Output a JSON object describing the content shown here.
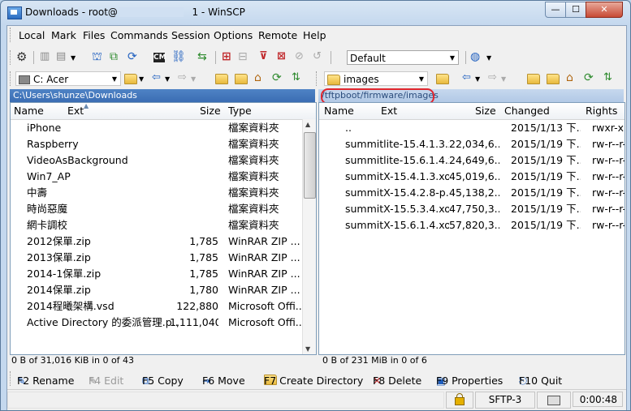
{
  "window": {
    "title": "Downloads - root@1                      1 - WinSCP",
    "min": "—",
    "max": "☐",
    "close": "✕"
  },
  "menu": [
    "Local",
    "Mark",
    "Files",
    "Commands",
    "Session",
    "Options",
    "Remote",
    "Help"
  ],
  "toolbar": {
    "transfer_profile": "Default"
  },
  "left": {
    "drive": "C: Acer",
    "path": "C:\\Users\\shunze\\Downloads",
    "columns": {
      "name": "Name",
      "ext": "Ext",
      "size": "Size",
      "type": "Type"
    },
    "rows": [
      {
        "name": "iPhone",
        "size": "",
        "type": "檔案資料夾",
        "icon": "folder"
      },
      {
        "name": "Raspberry",
        "size": "",
        "type": "檔案資料夾",
        "icon": "folder"
      },
      {
        "name": "VideoAsBackground",
        "size": "",
        "type": "檔案資料夾",
        "icon": "folder"
      },
      {
        "name": "Win7_AP",
        "size": "",
        "type": "檔案資料夾",
        "icon": "folder"
      },
      {
        "name": "中壽",
        "size": "",
        "type": "檔案資料夾",
        "icon": "folder"
      },
      {
        "name": "時尚惡魔",
        "size": "",
        "type": "檔案資料夾",
        "icon": "folder"
      },
      {
        "name": "網卡調校",
        "size": "",
        "type": "檔案資料夾",
        "icon": "folder"
      },
      {
        "name": "2012保單.zip",
        "size": "1,785",
        "type": "WinRAR ZIP ...",
        "icon": "zip"
      },
      {
        "name": "2013保單.zip",
        "size": "1,785",
        "type": "WinRAR ZIP ...",
        "icon": "zip"
      },
      {
        "name": "2014-1保單.zip",
        "size": "1,785",
        "type": "WinRAR ZIP ...",
        "icon": "zip"
      },
      {
        "name": "2014保單.zip",
        "size": "1,780",
        "type": "WinRAR ZIP ...",
        "icon": "zip"
      },
      {
        "name": "2014程曦架構.vsd",
        "size": "122,880",
        "type": "Microsoft Offi...",
        "icon": "visio"
      },
      {
        "name": "Active Directory 的委派管理.p...",
        "size": "1,111,040",
        "type": "Microsoft Offi...",
        "icon": "doc"
      }
    ],
    "status": "0 B of 31,016 KiB in 0 of 43"
  },
  "right": {
    "dir": "images",
    "path": "/tftpboot/firmware/images",
    "columns": {
      "name": "Name",
      "ext": "Ext",
      "size": "Size",
      "changed": "Changed",
      "rights": "Rights"
    },
    "rows": [
      {
        "name": "..",
        "size": "",
        "changed": "2015/1/13 下...",
        "rights": "rwxr-xr-x",
        "icon": "updir"
      },
      {
        "name": "summitlite-15.4.1.3.x...",
        "size": "22,034,6...",
        "changed": "2015/1/19 下...",
        "rights": "rw-r--r--",
        "icon": "doc"
      },
      {
        "name": "summitlite-15.6.1.4.x...",
        "size": "24,649,6...",
        "changed": "2015/1/19 下...",
        "rights": "rw-r--r--",
        "icon": "doc"
      },
      {
        "name": "summitX-15.4.1.3.xos",
        "size": "45,019,6...",
        "changed": "2015/1/19 下...",
        "rights": "rw-r--r--",
        "icon": "doc"
      },
      {
        "name": "summitX-15.4.2.8-p...",
        "size": "45,138,2...",
        "changed": "2015/1/19 下...",
        "rights": "rw-r--r--",
        "icon": "doc"
      },
      {
        "name": "summitX-15.5.3.4.xos",
        "size": "47,750,3...",
        "changed": "2015/1/19 下...",
        "rights": "rw-r--r--",
        "icon": "doc"
      },
      {
        "name": "summitX-15.6.1.4.xos",
        "size": "57,820,3...",
        "changed": "2015/1/19 下...",
        "rights": "rw-r--r--",
        "icon": "doc"
      }
    ],
    "status": "0 B of 231 MiB in 0 of 6"
  },
  "fkeys": [
    "F2 Rename",
    "F4 Edit",
    "F5 Copy",
    "F6 Move",
    "F7 Create Directory",
    "F8 Delete",
    "F9 Properties",
    "F10 Quit"
  ],
  "statusbar": {
    "protocol": "SFTP-3",
    "elapsed": "0:00:48"
  },
  "colors": {
    "accent": "#3a6db3",
    "highlight_ring": "#e0262e"
  }
}
